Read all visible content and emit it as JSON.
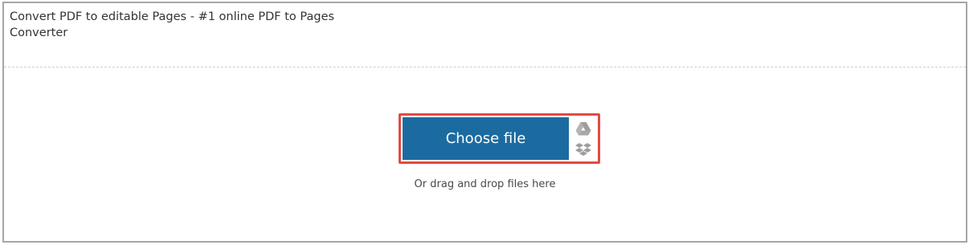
{
  "header": {
    "title": "Convert PDF to editable Pages - #1 online PDF to Pages Converter"
  },
  "upload": {
    "choose_file_label": "Choose file",
    "drop_hint": "Or drag and drop files here",
    "cloud_icons": [
      "google-drive-icon",
      "dropbox-icon"
    ]
  },
  "colors": {
    "button_bg": "#1b6ba1",
    "highlight_border": "#e24b42",
    "frame_border": "#a6a6a6",
    "icon_gray": "#9e9e9e"
  }
}
